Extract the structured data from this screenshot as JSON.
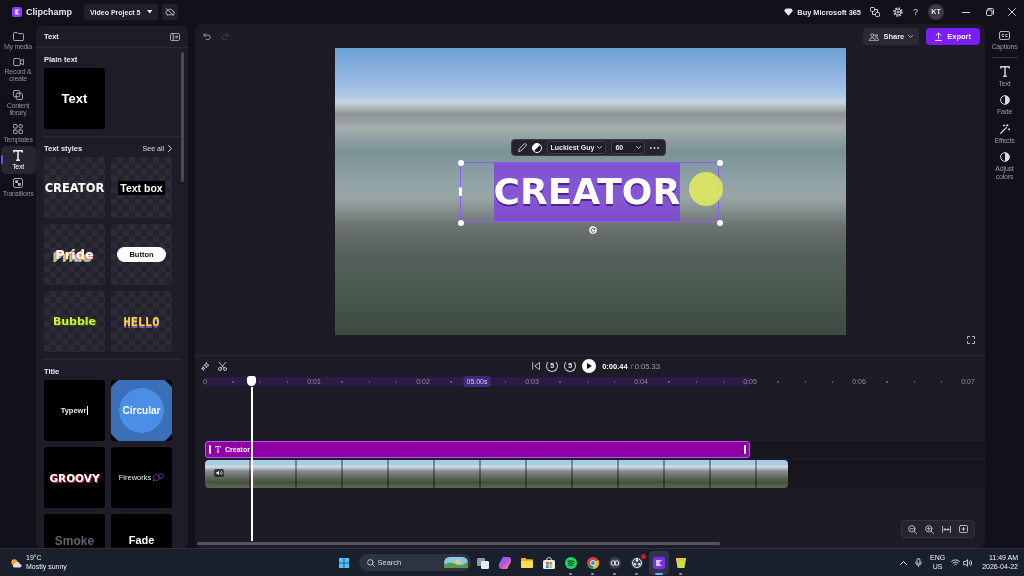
{
  "title_bar": {
    "app_name": "Clipchamp",
    "project": "Video Project 5",
    "promo": "Buy Microsoft 365",
    "help": "?",
    "avatar": "KT"
  },
  "left_rail": {
    "items": [
      {
        "label": "My media",
        "kind": "media",
        "selected": false
      },
      {
        "label": "Record & create",
        "kind": "record",
        "selected": false
      },
      {
        "label": "Content library",
        "kind": "library",
        "selected": false
      },
      {
        "label": "Templates",
        "kind": "templates",
        "selected": false
      },
      {
        "label": "Text",
        "kind": "text",
        "selected": true
      },
      {
        "label": "Transitions",
        "kind": "transitions",
        "selected": false
      }
    ]
  },
  "text_panel": {
    "title": "Text",
    "sections": [
      {
        "title": "Plain text",
        "tiles": [
          {
            "label": "Text",
            "kind": "plain"
          }
        ]
      },
      {
        "title": "Text styles",
        "action": "See all",
        "tiles": [
          {
            "label": "CREATOR",
            "kind": "creator"
          },
          {
            "label": "Text box",
            "kind": "textbox"
          },
          {
            "label": "Pride",
            "kind": "pride"
          },
          {
            "label": "Button",
            "kind": "button"
          },
          {
            "label": "Bubble",
            "kind": "bubble"
          },
          {
            "label": "HELLO",
            "kind": "retro"
          }
        ]
      },
      {
        "title": "Title",
        "tiles": [
          {
            "label": "Typewr",
            "kind": "typewriter"
          },
          {
            "label": "Circular",
            "kind": "circular"
          },
          {
            "label": "GROOVY",
            "kind": "groovy"
          },
          {
            "label": "Fireworks",
            "kind": "fireworks"
          },
          {
            "label": "Smoke",
            "kind": "smoke"
          },
          {
            "label": "Fade",
            "kind": "fade"
          }
        ]
      }
    ]
  },
  "preview": {
    "history": [
      {
        "kind": "undo",
        "disabled": false
      },
      {
        "kind": "redo",
        "disabled": true
      }
    ],
    "share": "Share",
    "export": "Export",
    "text_overlay": {
      "text": "CREATOR",
      "font": "Luckiest Guy",
      "size": "60"
    }
  },
  "timeline": {
    "transport": {
      "skip_back": "5",
      "skip_forward": "5"
    },
    "current_time": "0:00.44",
    "total_time": "/ 0:05.33",
    "ruler": [
      "0",
      "0:01",
      "0:02",
      "0:03",
      "0:04",
      "0:05",
      "0:06",
      "0:07"
    ],
    "selection_duration": "05.00s",
    "playhead": {
      "level": 0.061
    },
    "text_clip": {
      "label": "Creator"
    }
  },
  "right_rail": {
    "items": [
      {
        "label": "Captions",
        "kind": "captions"
      },
      {
        "label": "Text",
        "kind": "text"
      },
      {
        "label": "Fade",
        "kind": "fade"
      },
      {
        "label": "Effects",
        "kind": "effects"
      },
      {
        "label": "Adjust colors",
        "kind": "adjust"
      }
    ]
  },
  "taskbar": {
    "weather": {
      "temperature": "19°C",
      "condition": "Mostly sunny"
    },
    "search": {
      "placeholder": "Search"
    },
    "apps": [
      {
        "kind": "task-view",
        "running": false,
        "selected": false,
        "badge": false
      },
      {
        "kind": "copilot",
        "running": false,
        "selected": false,
        "badge": false
      },
      {
        "kind": "explorer",
        "running": false,
        "selected": false,
        "badge": false
      },
      {
        "kind": "store",
        "running": false,
        "selected": false,
        "badge": false
      },
      {
        "kind": "spotify",
        "running": true,
        "selected": false,
        "badge": false
      },
      {
        "kind": "chrome",
        "running": true,
        "selected": false,
        "badge": false
      },
      {
        "kind": "rings",
        "running": true,
        "selected": false,
        "badge": false
      },
      {
        "kind": "obs",
        "running": true,
        "selected": false,
        "badge": true
      },
      {
        "kind": "clipchamp",
        "running": true,
        "selected": true,
        "badge": false
      },
      {
        "kind": "cup",
        "running": true,
        "selected": false,
        "badge": false
      }
    ],
    "language": {
      "input": "ENG",
      "region": "US"
    },
    "clock": {
      "time": "11:49 AM",
      "date": "2026-04-22"
    }
  }
}
